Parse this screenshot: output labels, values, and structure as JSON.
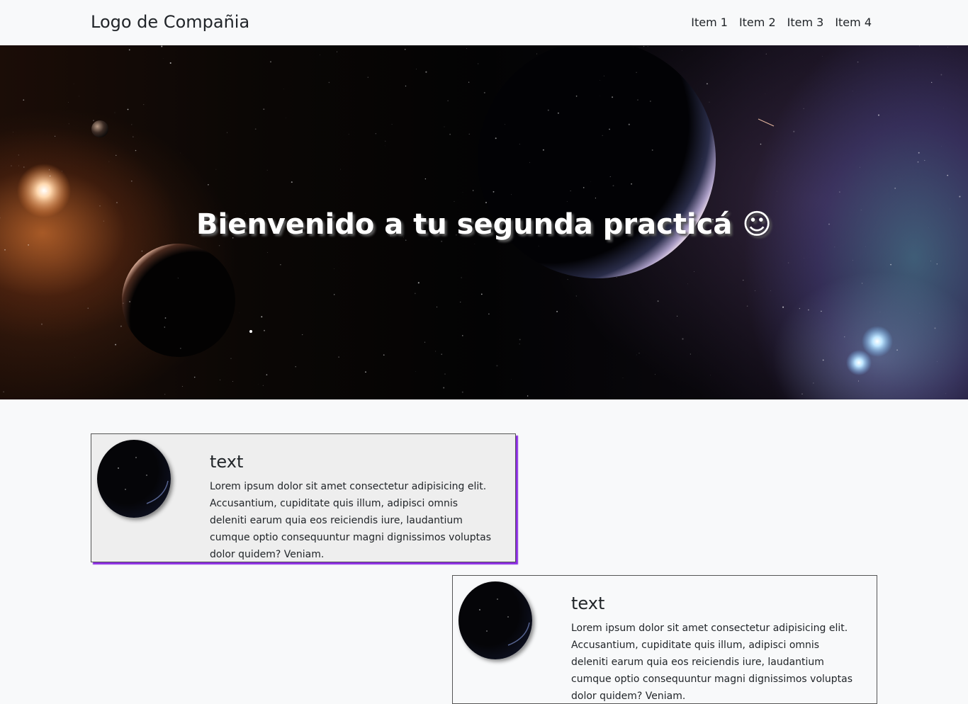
{
  "navbar": {
    "brand": "Logo de Compañia",
    "items": [
      {
        "label": "Item 1"
      },
      {
        "label": "Item 2"
      },
      {
        "label": "Item 3"
      },
      {
        "label": "Item 4"
      }
    ]
  },
  "hero": {
    "title": "Bienvenido a tu segunda practicá ☺"
  },
  "cards": [
    {
      "title": "text",
      "body": "Lorem ipsum dolor sit amet consectetur adipisicing elit. Accusantium, cupiditate quis illum, adipisci omnis deleniti earum quia eos reiciendis iure, laudantium cumque optio consequuntur magni dignissimos voluptas dolor quidem? Veniam."
    },
    {
      "title": "text",
      "body": "Lorem ipsum dolor sit amet consectetur adipisicing elit. Accusantium, cupiditate quis illum, adipisci omnis deleniti earum quia eos reiciendis iure, laudantium cumque optio consequuntur magni dignissimos voluptas dolor quidem? Veniam."
    }
  ],
  "colors": {
    "card_accent_shadow": "#8a2be2",
    "page_background": "#f8f9fa",
    "card_background": "#eeeeee"
  }
}
